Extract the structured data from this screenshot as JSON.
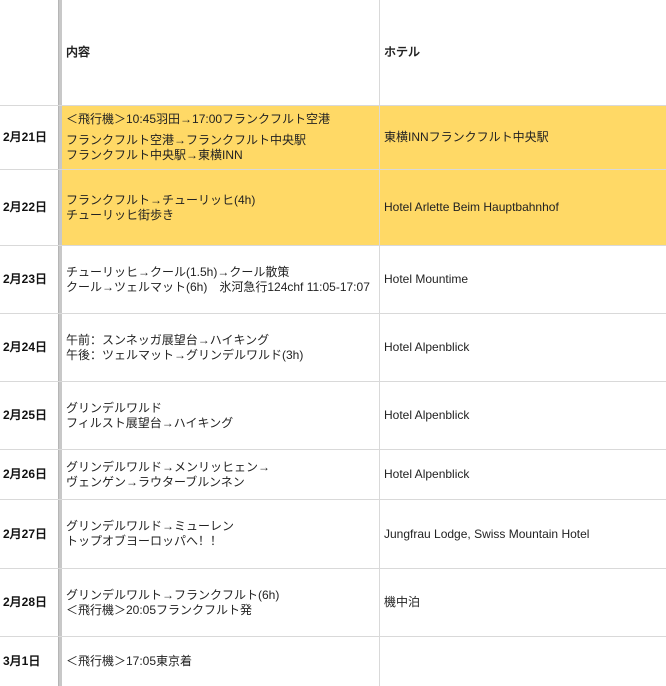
{
  "header": {
    "date": "",
    "content": "内容",
    "hotel": "ホテル"
  },
  "rows": [
    {
      "date": "2月21日",
      "content": [
        "＜飛行機＞10:45羽田→17:00フランクフルト空港",
        "フランクフルト空港→フランクフルト中央駅",
        "フランクフルト中央駅→東横INN"
      ],
      "hotel": "東横INNフランクフルト中央駅",
      "highlight": true
    },
    {
      "date": "2月22日",
      "content": [
        "フランクフルト→チューリッヒ(4h)",
        "チューリッヒ街歩き"
      ],
      "hotel": "Hotel Arlette Beim Hauptbahnhof",
      "highlight": true
    },
    {
      "date": "2月23日",
      "content": [
        "チューリッヒ→クール(1.5h)→クール散策",
        "クール→ツェルマット(6h)　氷河急行124chf 11:05-17:07"
      ],
      "hotel": "Hotel Mountime",
      "highlight": false
    },
    {
      "date": "2月24日",
      "content": [
        "午前：スンネッガ展望台→ハイキング",
        "午後：ツェルマット→グリンデルワルド(3h)"
      ],
      "hotel": "Hotel Alpenblick",
      "highlight": false
    },
    {
      "date": "2月25日",
      "content": [
        "グリンデルワルド",
        "フィルスト展望台→ハイキング"
      ],
      "hotel": "Hotel Alpenblick",
      "highlight": false
    },
    {
      "date": "2月26日",
      "content": [
        "グリンデルワルド→メンリッヒェン→",
        "ヴェンゲン→ラウターブルンネン"
      ],
      "hotel": "Hotel Alpenblick",
      "highlight": false
    },
    {
      "date": "2月27日",
      "content": [
        "グリンデルワルド→ミューレン",
        "トップオブヨーロッパへ！！"
      ],
      "hotel": "Jungfrau Lodge, Swiss Mountain Hotel",
      "highlight": false
    },
    {
      "date": "2月28日",
      "content": [
        "グリンデルワルト→フランクフルト(6h)",
        "＜飛行機＞20:05フランクフルト発"
      ],
      "hotel": "機中泊",
      "highlight": false
    },
    {
      "date": "3月1日",
      "content": [
        "＜飛行機＞17:05東京着"
      ],
      "hotel": "",
      "highlight": false
    }
  ]
}
